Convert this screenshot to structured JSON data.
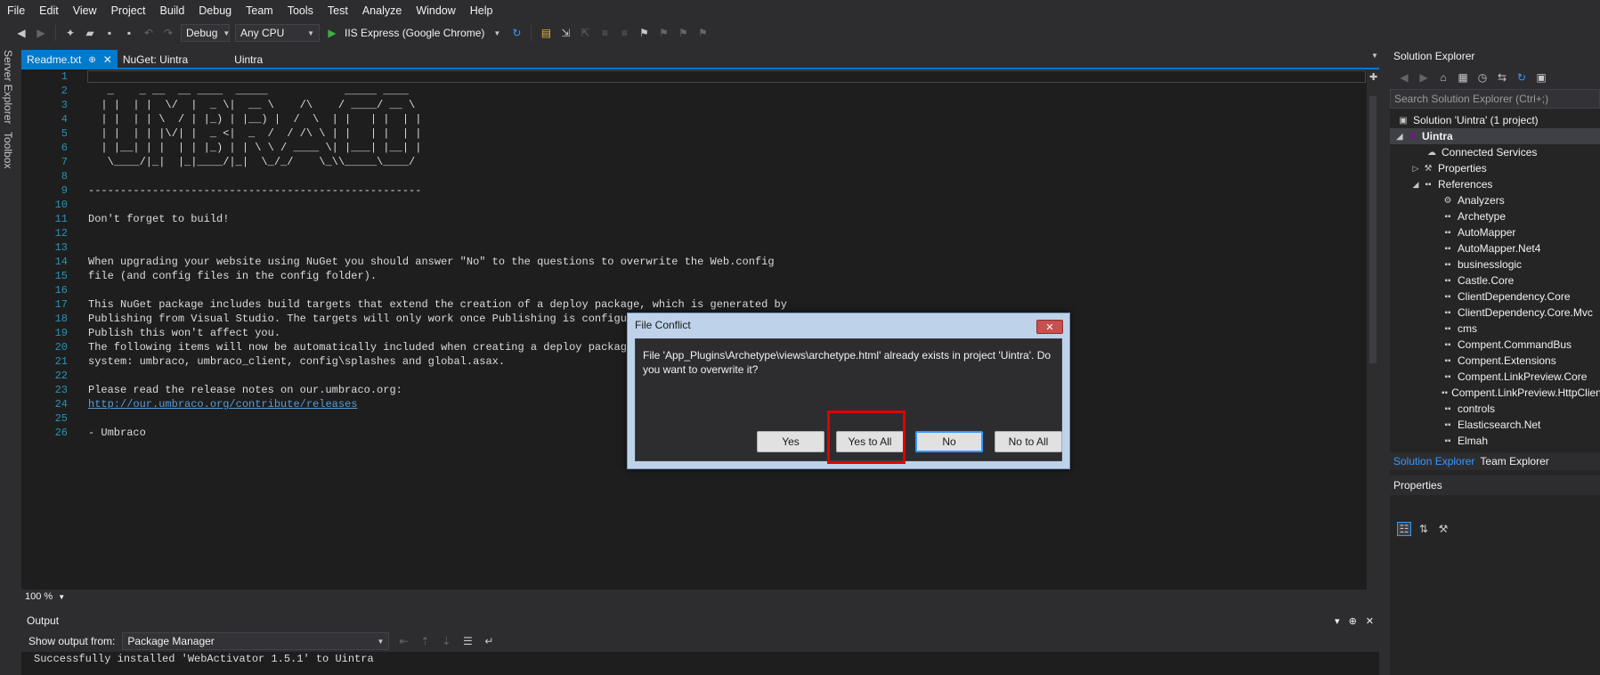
{
  "menu": [
    "File",
    "Edit",
    "View",
    "Project",
    "Build",
    "Debug",
    "Team",
    "Tools",
    "Test",
    "Analyze",
    "Window",
    "Help"
  ],
  "toolbar": {
    "config": "Debug",
    "platform": "Any CPU",
    "run_label": "IIS Express (Google Chrome)"
  },
  "left_strip": {
    "server_explorer": "Server Explorer",
    "toolbox": "Toolbox"
  },
  "tabs": [
    {
      "label": "Readme.txt",
      "pin": "⊕",
      "close": "✕"
    },
    {
      "label": "NuGet: Uintra"
    },
    {
      "label": "Uintra"
    }
  ],
  "editor": {
    "line_numbers": [
      "1",
      "2",
      "3",
      "4",
      "5",
      "6",
      "7",
      "8",
      "9",
      "10",
      "11",
      "12",
      "13",
      "14",
      "15",
      "16",
      "17",
      "18",
      "19",
      "20",
      "21",
      "22",
      "23",
      "24",
      "25",
      "26"
    ],
    "lines": [
      "",
      "   _    _ __  __ ____  _____            _____ ____",
      "  | |  | |  \\/  |  _ \\|  __ \\    /\\    / ____/ __ \\",
      "  | |  | | \\  / | |_) | |__) |  /  \\  | |   | |  | |",
      "  | |  | | |\\/| |  _ <|  _  /  / /\\ \\ | |   | |  | |",
      "  | |__| | |  | | |_) | | \\ \\ / ____ \\| |___| |__| |",
      "   \\____/|_|  |_|____/|_|  \\_/_/    \\_\\\\_____\\____/",
      "",
      "----------------------------------------------------",
      "",
      "Don't forget to build!",
      "",
      "",
      "When upgrading your website using NuGet you should answer \"No\" to the questions to overwrite the Web.config",
      "file (and config files in the config folder).",
      "",
      "This NuGet package includes build targets that extend the creation of a deploy package, which is generated by",
      "Publishing from Visual Studio. The targets will only work once Publishing is configured",
      "Publish this won't affect you.",
      "The following items will now be automatically included when creating a deploy package o",
      "system: umbraco, umbraco_client, config\\splashes and global.asax.",
      "",
      "Please read the release notes on our.umbraco.org:",
      "",
      "",
      "- Umbraco"
    ],
    "link": "http://our.umbraco.org/contribute/releases"
  },
  "zoom": "100 %",
  "output": {
    "title": "Output",
    "show_from_label": "Show output from:",
    "source": "Package Manager",
    "text": "Successfully installed 'WebActivator 1.5.1' to Uintra"
  },
  "solution_explorer": {
    "title": "Solution Explorer",
    "search_placeholder": "Search Solution Explorer (Ctrl+;)",
    "solution": "Solution 'Uintra' (1 project)",
    "project": "Uintra",
    "connected_services": "Connected Services",
    "properties": "Properties",
    "references": "References",
    "refs": [
      "Analyzers",
      "Archetype",
      "AutoMapper",
      "AutoMapper.Net4",
      "businesslogic",
      "Castle.Core",
      "ClientDependency.Core",
      "ClientDependency.Core.Mvc",
      "cms",
      "Compent.CommandBus",
      "Compent.Extensions",
      "Compent.LinkPreview.Core",
      "Compent.LinkPreview.HttpClient",
      "controls",
      "Elasticsearch.Net",
      "Elmah"
    ],
    "tab_solution": "Solution Explorer",
    "tab_team": "Team Explorer"
  },
  "properties_panel": {
    "title": "Properties"
  },
  "dialog": {
    "title": "File Conflict",
    "message": "File 'App_Plugins\\Archetype\\views\\archetype.html' already exists in project 'Uintra'. Do you want to overwrite it?",
    "yes": "Yes",
    "yes_to_all": "Yes to All",
    "no": "No",
    "no_to_all": "No to All"
  },
  "colors": {
    "accent": "#007acc",
    "highlight": "#e00000",
    "editor_bg": "#1e1e1e"
  }
}
